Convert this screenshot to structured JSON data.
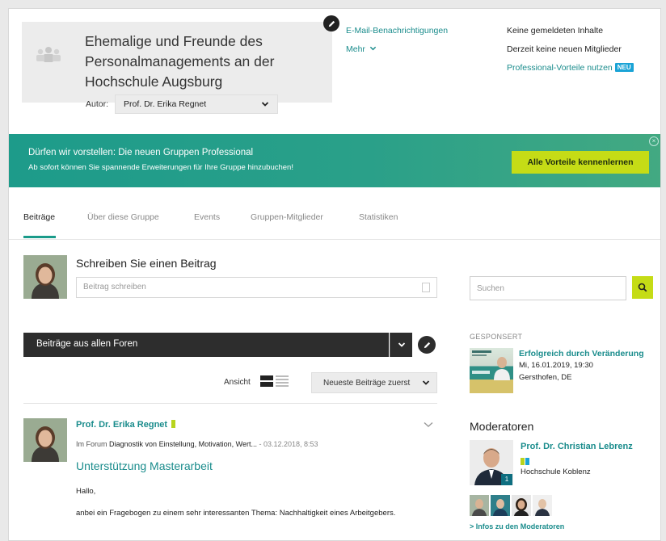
{
  "group": {
    "title": "Ehemalige und Freunde des Personalmanagements an der Hochschule Augsburg",
    "author_label": "Autor:",
    "author_value": "Prof. Dr. Erika Regnet"
  },
  "header_links": {
    "email": "E-Mail-Benachrichtigungen",
    "more": "Mehr"
  },
  "header_info": {
    "no_reported": "Keine gemeldeten Inhalte",
    "no_new_members": "Derzeit keine neuen Mitglieder",
    "professional": "Professional-Vorteile nutzen",
    "badge": "NEU"
  },
  "banner": {
    "title": "Dürfen wir vorstellen: Die neuen Gruppen Professional",
    "subtitle": "Ab sofort können Sie spannende Erweiterungen für Ihre Gruppe hinzubuchen!",
    "button": "Alle Vorteile kennenlernen"
  },
  "tabs": [
    "Beiträge",
    "Über diese Gruppe",
    "Events",
    "Gruppen-Mitglieder",
    "Statistiken"
  ],
  "composer": {
    "title": "Schreiben Sie einen Beitrag",
    "placeholder": "Beitrag schreiben"
  },
  "search": {
    "placeholder": "Suchen"
  },
  "forum_filter": {
    "label": "Beiträge aus allen Foren"
  },
  "view": {
    "label": "Ansicht",
    "sort": "Neueste Beiträge zuerst"
  },
  "post": {
    "author": "Prof. Dr. Erika Regnet",
    "meta_prefix": "Im Forum",
    "forum": "Diagnostik von Einstellung, Motivation, Wert...",
    "date": "- 03.12.2018, 8:53",
    "title": "Unterstützung Masterarbeit",
    "greeting": "Hallo,",
    "body": "anbei ein Fragebogen zu einem sehr interessanten Thema: Nachhaltigkeit eines Arbeitgebers."
  },
  "sponsored": {
    "label": "GESPONSERT",
    "title": "Erfolgreich durch Veränderung",
    "date": "Mi, 16.01.2019, 19:30",
    "location": "Gersthofen, DE"
  },
  "moderators": {
    "title": "Moderatoren",
    "name": "Prof. Dr. Christian Lebrenz",
    "org": "Hochschule Koblenz",
    "count": "1",
    "link": "Infos zu den Moderatoren"
  },
  "colors": {
    "accent": "#1a8c8c",
    "lime": "#c5dc16",
    "banner": "#2aa089",
    "dark": "#2d2d2d"
  }
}
